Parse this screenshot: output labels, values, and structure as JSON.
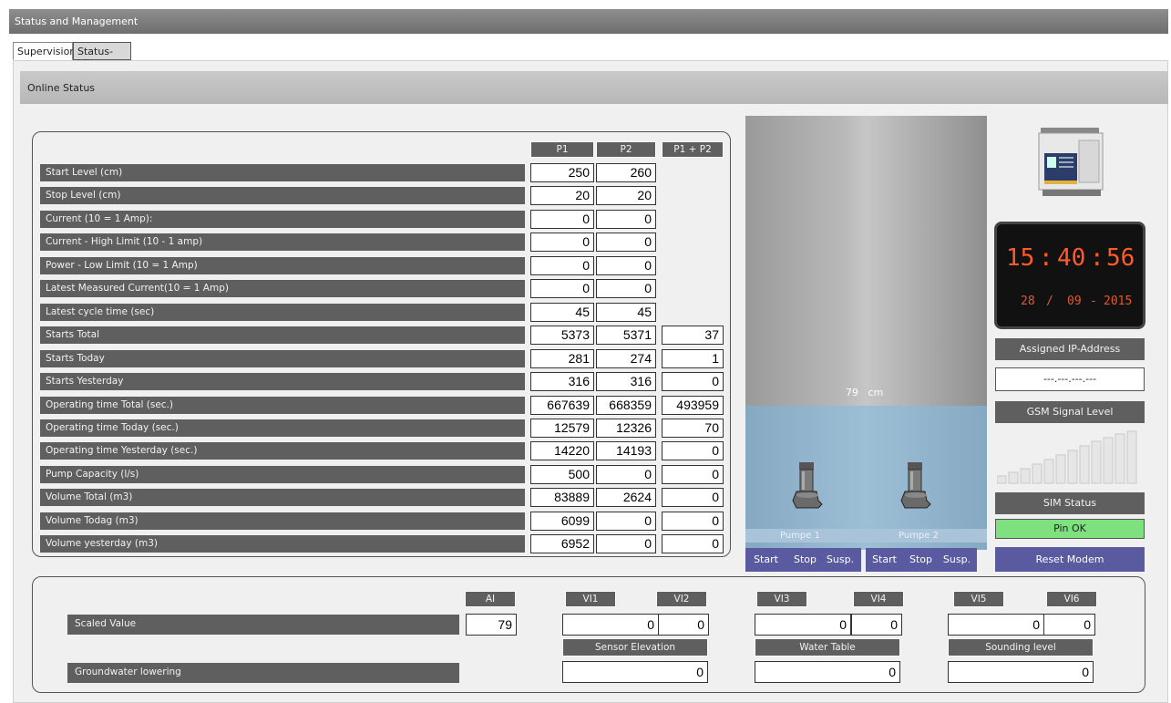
{
  "window": {
    "title": "Status and Management"
  },
  "tabs": [
    {
      "label": "Supervision"
    },
    {
      "label": "Status-bits"
    }
  ],
  "panel": {
    "title": "Online Status"
  },
  "table": {
    "headers": [
      "P1",
      "P2",
      "P1 + P2"
    ],
    "rows": [
      {
        "label": "Start Level (cm)",
        "p1": "250",
        "p2": "260",
        "sum": ""
      },
      {
        "label": "Stop Level (cm)",
        "p1": "20",
        "p2": "20",
        "sum": ""
      },
      {
        "label": "Current (10 = 1 Amp):",
        "p1": "0",
        "p2": "0",
        "sum": ""
      },
      {
        "label": "Current - High Limit (10 - 1 amp)",
        "p1": "0",
        "p2": "0",
        "sum": ""
      },
      {
        "label": "Power - Low Limit (10 = 1 Amp)",
        "p1": "0",
        "p2": "0",
        "sum": ""
      },
      {
        "label": "Latest Measured Current(10 = 1 Amp)",
        "p1": "0",
        "p2": "0",
        "sum": ""
      },
      {
        "label": "Latest cycle time (sec)",
        "p1": "45",
        "p2": "45",
        "sum": ""
      },
      {
        "label": "Starts Total",
        "p1": "5373",
        "p2": "5371",
        "sum": "37"
      },
      {
        "label": "Starts Today",
        "p1": "281",
        "p2": "274",
        "sum": "1"
      },
      {
        "label": "Starts Yesterday",
        "p1": "316",
        "p2": "316",
        "sum": "0"
      },
      {
        "label": "Operating time Total (sec.)",
        "p1": "667639",
        "p2": "668359",
        "sum": "493959"
      },
      {
        "label": "Operating time Today (sec.)",
        "p1": "12579",
        "p2": "12326",
        "sum": "70"
      },
      {
        "label": "Operating time Yesterday (sec.)",
        "p1": "14220",
        "p2": "14193",
        "sum": "0"
      },
      {
        "label": "Pump Capacity (l/s)",
        "p1": "500",
        "p2": "0",
        "sum": "0"
      },
      {
        "label": "Volume Total (m3)",
        "p1": "83889",
        "p2": "2624",
        "sum": "0"
      },
      {
        "label": "Volume Todag (m3)",
        "p1": "6099",
        "p2": "0",
        "sum": "0"
      },
      {
        "label": "Volume yesterday (m3)",
        "p1": "6952",
        "p2": "0",
        "sum": "0"
      }
    ]
  },
  "tank": {
    "level_value": "79",
    "level_unit": "cm",
    "pump1_label": "Pumpe 1",
    "pump2_label": "Pumpe 2"
  },
  "pump_buttons": {
    "start": "Start",
    "stop": "Stop",
    "suspend": "Susp."
  },
  "side": {
    "clock_time": {
      "h": "15",
      "m": "40",
      "s": "56"
    },
    "clock_date": {
      "d": "28",
      "mo": "09",
      "y": "2015"
    },
    "ip_label": "Assigned IP-Address",
    "ip_value": "---.---.---.---",
    "gsm_label": "GSM Signal Level",
    "sim_label": "SIM Status",
    "sim_value": "Pin OK",
    "reset_button": "Reset Modem"
  },
  "bottom": {
    "channel_headers": [
      "AI",
      "VI1",
      "VI2",
      "VI3",
      "VI4",
      "VI5",
      "VI6"
    ],
    "scaled_label": "Scaled Value",
    "scaled_values": [
      "79",
      "0",
      "0",
      "0",
      "0",
      "0",
      "0"
    ],
    "sub_headers": [
      "Sensor Elevation",
      "Water Table",
      "Sounding level"
    ],
    "gw_label": "Groundwater lowering",
    "gw_values": [
      "0",
      "0",
      "0"
    ]
  },
  "colors": {
    "label_bg": "#5f5f5f",
    "pump_button": "#5a5aa0",
    "sim_ok": "#7ee07e",
    "clock_digits": "#ff5a2a",
    "water": "#9dbfd6"
  }
}
